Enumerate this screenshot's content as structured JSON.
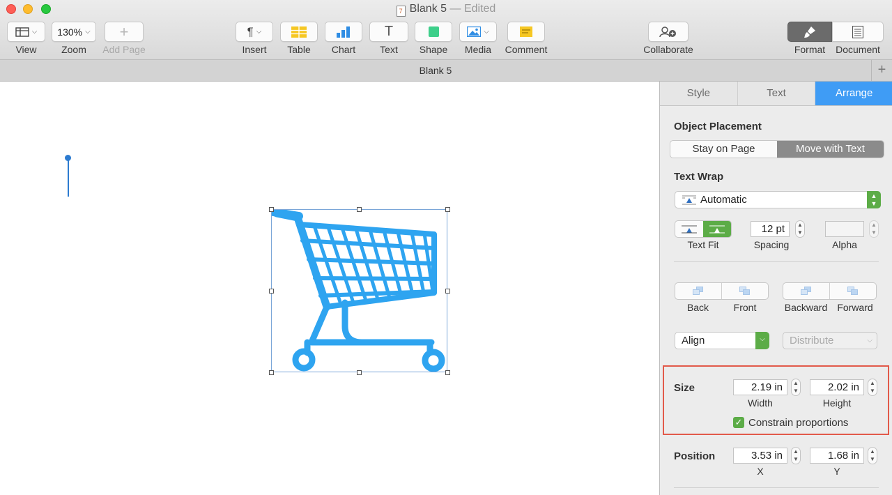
{
  "window": {
    "doc_name": "Blank 5",
    "doc_status": "— Edited"
  },
  "toolbar": {
    "view_label": "View",
    "zoom_value": "130%",
    "zoom_label": "Zoom",
    "add_page_label": "Add Page",
    "insert_label": "Insert",
    "table_label": "Table",
    "chart_label": "Chart",
    "text_label": "Text",
    "shape_label": "Shape",
    "media_label": "Media",
    "comment_label": "Comment",
    "collaborate_label": "Collaborate",
    "format_label": "Format",
    "document_label": "Document"
  },
  "tabbar": {
    "title": "Blank 5",
    "add": "+"
  },
  "colors": {
    "accent": "#3f9cf5",
    "cart": "#2ea4f0",
    "highlight": "#e25a4a",
    "green": "#5cac47"
  },
  "inspector": {
    "tabs": [
      "Style",
      "Text",
      "Arrange"
    ],
    "active_tab": "Arrange",
    "object_placement": {
      "title": "Object Placement",
      "options": [
        "Stay on Page",
        "Move with Text"
      ],
      "selected": "Move with Text"
    },
    "text_wrap": {
      "title": "Text Wrap",
      "value": "Automatic",
      "text_fit_label": "Text Fit",
      "spacing_value": "12 pt",
      "spacing_label": "Spacing",
      "alpha_value": "",
      "alpha_label": "Alpha"
    },
    "arrange": {
      "back_label": "Back",
      "front_label": "Front",
      "backward_label": "Backward",
      "forward_label": "Forward"
    },
    "align": {
      "label": "Align",
      "distribute_label": "Distribute"
    },
    "size": {
      "title": "Size",
      "width": "2.19 in",
      "width_label": "Width",
      "height": "2.02 in",
      "height_label": "Height",
      "constrain_label": "Constrain proportions",
      "constrain_checked": true
    },
    "position": {
      "title": "Position",
      "x": "3.53 in",
      "x_label": "X",
      "y": "1.68 in",
      "y_label": "Y"
    }
  }
}
